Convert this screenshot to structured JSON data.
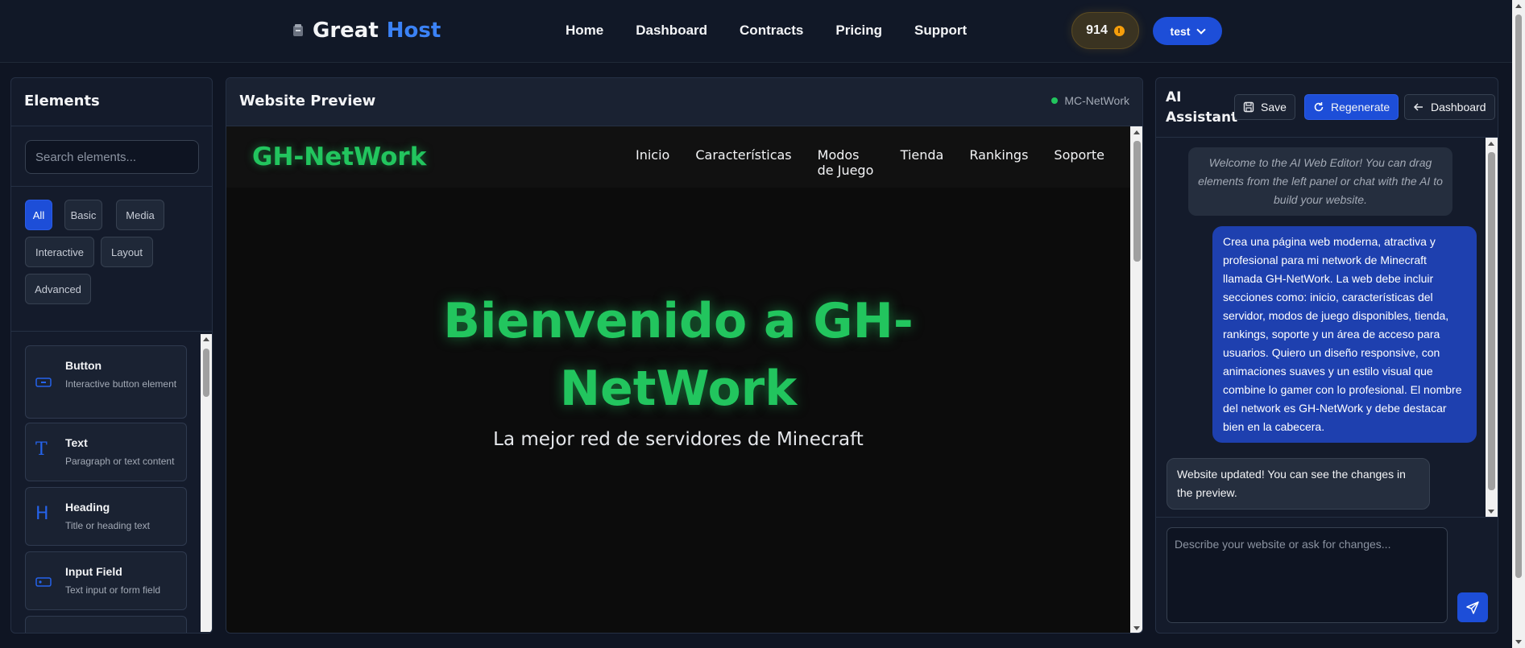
{
  "header": {
    "brand_part1": "Great",
    "brand_part2": "Host",
    "nav": [
      "Home",
      "Dashboard",
      "Contracts",
      "Pricing",
      "Support"
    ],
    "credits": "914",
    "user": "test"
  },
  "elements_panel": {
    "title": "Elements",
    "search_placeholder": "Search elements...",
    "categories": [
      "All",
      "Basic",
      "Media",
      "Interactive",
      "Layout",
      "Advanced"
    ],
    "active_category": "All",
    "items": [
      {
        "icon": "button-icon",
        "title": "Button",
        "desc": "Interactive button element"
      },
      {
        "icon": "text-icon",
        "title": "Text",
        "desc": "Paragraph or text content"
      },
      {
        "icon": "heading-icon",
        "title": "Heading",
        "desc": "Title or heading text"
      },
      {
        "icon": "input-field-icon",
        "title": "Input Field",
        "desc": "Text input or form field"
      }
    ]
  },
  "preview_panel": {
    "title": "Website Preview",
    "status": "MC-NetWork",
    "site": {
      "brand": "GH-NetWork",
      "nav": [
        "Inicio",
        "Características",
        "Modos de Juego",
        "Tienda",
        "Rankings",
        "Soporte"
      ],
      "hero_title": "Bienvenido a GH-NetWork",
      "hero_subtitle": "La mejor red de servidores de Minecraft"
    }
  },
  "assistant_panel": {
    "title": "AI Assistant",
    "save_label": "Save",
    "regenerate_label": "Regenerate",
    "dashboard_label": "Dashboard",
    "system_message": "Welcome to the AI Web Editor! You can drag elements from the left panel or chat with the AI to build your website.",
    "user_message": "Crea una página web moderna, atractiva y profesional para mi network de Minecraft llamada GH-NetWork. La web debe incluir secciones como: inicio, características del servidor, modos de juego disponibles, tienda, rankings, soporte y un área de acceso para usuarios. Quiero un diseño responsive, con animaciones suaves y un estilo visual que combine lo gamer con lo profesional. El nombre del network es GH-NetWork y debe destacar bien en la cabecera.",
    "bot_message": "Website updated! You can see the changes in the preview.",
    "input_placeholder": "Describe your website or ask for changes..."
  },
  "colors": {
    "accent": "#1d4ed8",
    "brand_green": "#22c55e",
    "background": "#0f1523"
  }
}
